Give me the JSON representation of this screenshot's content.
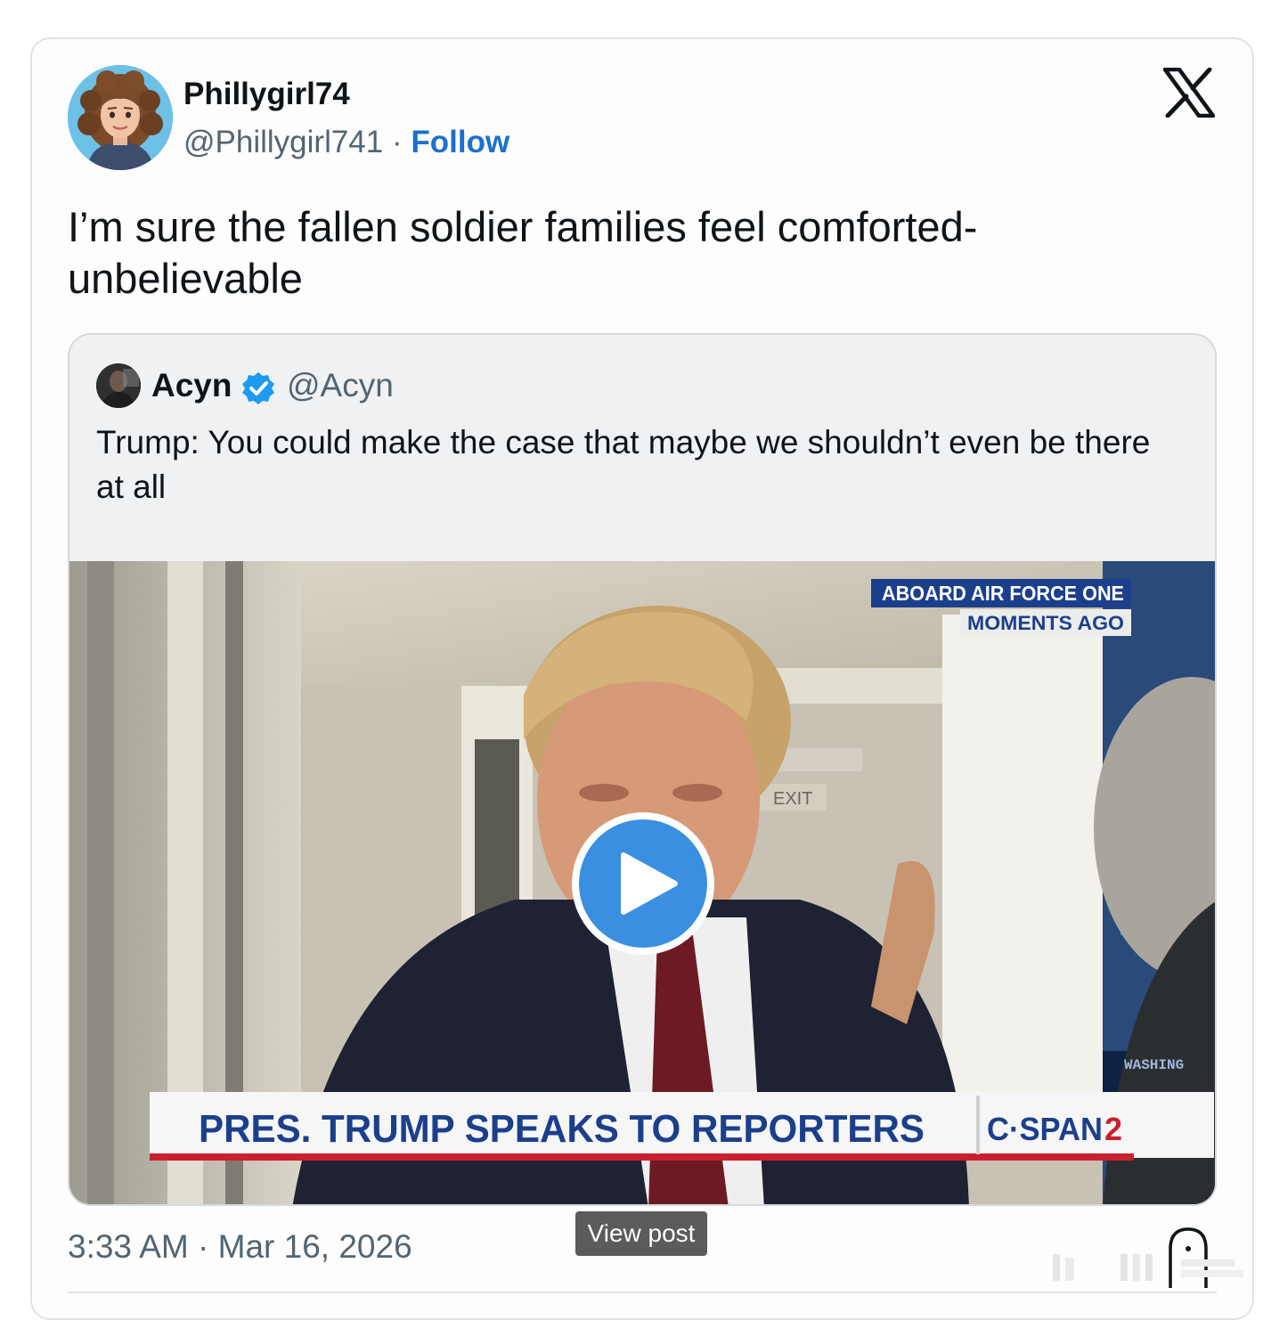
{
  "tweet": {
    "author_name": "Phillygirl74",
    "author_handle": "@Phillygirl741",
    "separator": " · ",
    "follow_label": "Follow",
    "text": "I’m sure the fallen soldier families feel comforted- unbelievable",
    "timestamp": "3:33 AM · Mar 16, 2026",
    "view_post_label": "View post",
    "platform_icon": "x-logo-icon",
    "info_icon": "info-icon"
  },
  "quote": {
    "author_name": "Acyn",
    "author_handle": "@Acyn",
    "verified": true,
    "text": "Trump: You could make the case that maybe we shouldn’t even be there at all",
    "video": {
      "overlay_top_line1": "ABOARD AIR FORCE ONE",
      "overlay_top_line2": "MOMENTS AGO",
      "lower_third": "PRES. TRUMP SPEAKS TO REPORTERS",
      "network": "C·SPAN",
      "network_channel": "2",
      "corner_text": "WASHING",
      "exit_sign": "EXIT",
      "play_icon": "play-icon"
    }
  },
  "colors": {
    "link_blue": "#1d6fd1",
    "verified_blue": "#1d9bf0",
    "play_blue": "#3b8fe0",
    "cspan_blue": "#1c3f8c",
    "cspan_red": "#c8202f"
  }
}
